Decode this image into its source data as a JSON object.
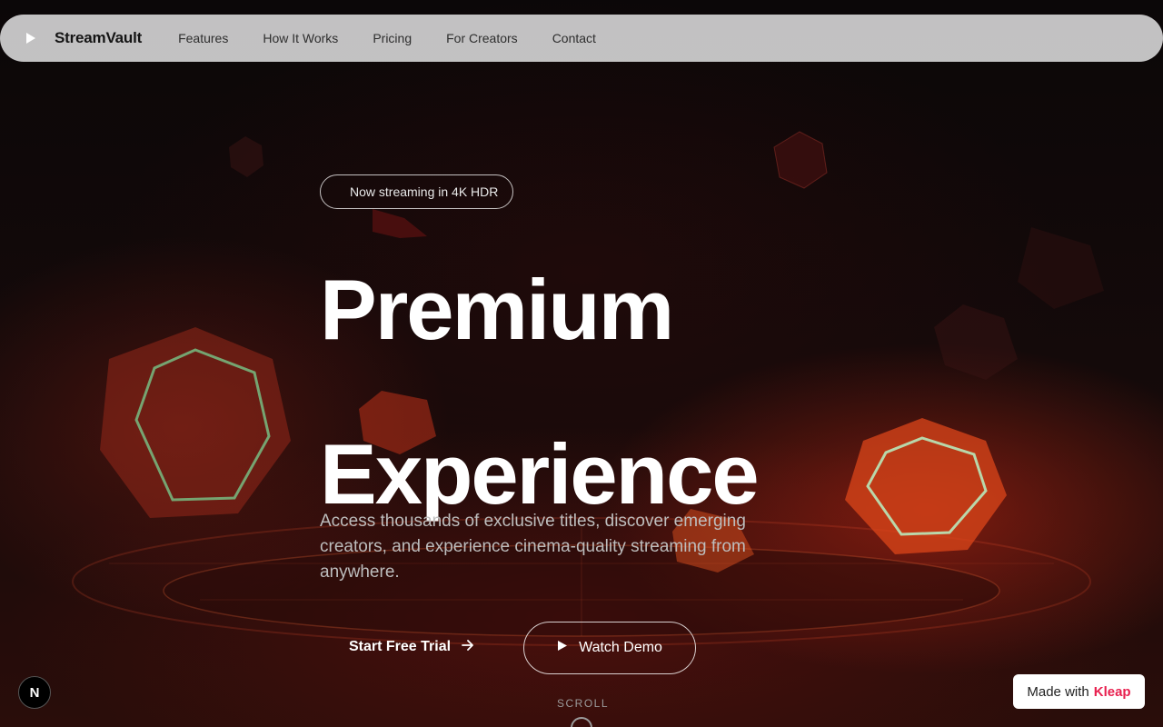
{
  "nav": {
    "brand": "StreamVault",
    "logo_icon": "play-icon",
    "links": [
      "Features",
      "How It Works",
      "Pricing",
      "For Creators",
      "Contact"
    ]
  },
  "hero": {
    "badge": "Now streaming in 4K HDR",
    "headline_line1": "Premium",
    "headline_line2": "Experience",
    "subtext": "Access thousands of exclusive titles, discover emerging creators, and experience cinema-quality streaming from anywhere.",
    "primary_cta": "Start Free Trial",
    "secondary_cta": "Watch Demo",
    "scroll_label": "SCROLL"
  },
  "footer_badges": {
    "next_label": "N",
    "made_with": "Made with",
    "made_with_brand": "Kleap"
  },
  "colors": {
    "accent": "#e8204f",
    "hex_glow": "#ff4a1f",
    "hex_outline": "#7dffb0"
  }
}
